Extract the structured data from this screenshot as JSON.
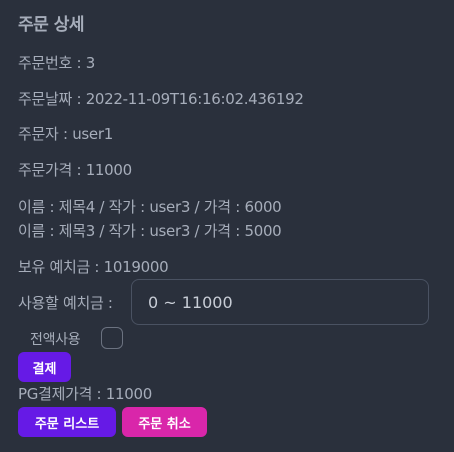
{
  "page": {
    "title": "주문 상세"
  },
  "order": {
    "number_line": "주문번호 : 3",
    "date_line": "주문날짜 : 2022-11-09T16:16:02.436192",
    "orderer_line": "주문자 : user1",
    "price_line": "주문가격 : 11000",
    "items": [
      {
        "line": "이름 : 제목4 / 작가 : user3 / 가격 : 6000"
      },
      {
        "line": "이름 : 제목3 / 작가 : user3 / 가격 : 5000"
      }
    ],
    "balance_line": "보유 예치금 : 1019000"
  },
  "payment": {
    "deposit_label": "사용할 예치금 :",
    "deposit_placeholder": "0 ~ 11000",
    "fullpay_label": "전액사용",
    "fullpay_checked": false,
    "pay_button": "결제",
    "pg_amount_line": "PG결제가격 : 11000"
  },
  "actions": {
    "list_button": "주문 리스트",
    "cancel_button": "주문 취소"
  },
  "colors": {
    "background": "#2a303c",
    "text": "#a6adba",
    "primary": "#661ae6",
    "secondary": "#d926aa"
  }
}
